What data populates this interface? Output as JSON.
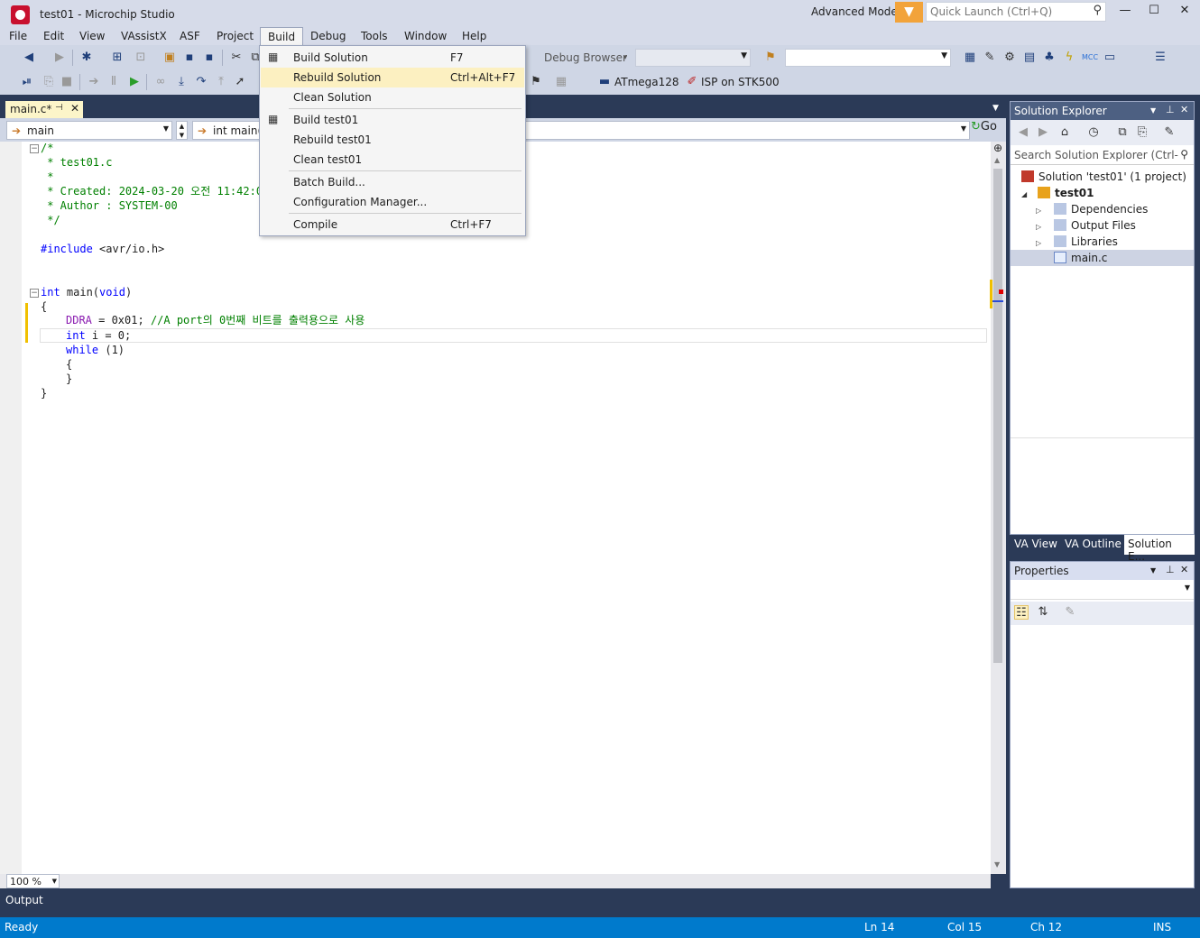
{
  "window": {
    "title": "test01 - Microchip Studio",
    "mode_label": "Advanced Mode",
    "quick_launch_placeholder": "Quick Launch (Ctrl+Q)"
  },
  "menu": [
    "File",
    "Edit",
    "View",
    "VAssistX",
    "ASF",
    "Project",
    "Build",
    "Debug",
    "Tools",
    "Window",
    "Help"
  ],
  "build_menu": {
    "items": [
      {
        "label": "Build Solution",
        "shortcut": "F7"
      },
      {
        "label": "Rebuild Solution",
        "shortcut": "Ctrl+Alt+F7"
      },
      {
        "label": "Clean Solution",
        "shortcut": ""
      },
      {
        "label": "Build test01",
        "shortcut": ""
      },
      {
        "label": "Rebuild test01",
        "shortcut": ""
      },
      {
        "label": "Clean test01",
        "shortcut": ""
      },
      {
        "label": "Batch Build...",
        "shortcut": ""
      },
      {
        "label": "Configuration Manager...",
        "shortcut": ""
      },
      {
        "label": "Compile",
        "shortcut": "Ctrl+F7"
      }
    ],
    "highlighted": "Rebuild Solution"
  },
  "toolbar": {
    "debug_browser": "Debug Browser",
    "device": "ATmega128",
    "tool": "ISP on STK500",
    "go_label": "Go"
  },
  "editor": {
    "tab_label": "main.c*",
    "nav_scope": "main",
    "nav_function": "int main(",
    "zoom": "100 %",
    "code": {
      "l1": "/*",
      "l2": " * test01.c",
      "l3": " *",
      "l4": " * Created: 2024-03-20 오전 11:42:0",
      "l5": " * Author : SYSTEM-00",
      "l6": " */",
      "l7_kw": "#include",
      "l7_rest": " <avr/io.h>",
      "l8_kw": "int",
      "l8_rest": " main(",
      "l8_kw2": "void",
      "l8_end": ")",
      "l9": "{",
      "l10_mac": "DDRA",
      "l10_rest": " = 0x01; ",
      "l10_cm": "//A port의 0번째 비트를 출력용으로 사용",
      "l11_kw": "int",
      "l11_rest": " i = 0;",
      "l12_kw": "while",
      "l12_rest": " (1)",
      "l13": "{",
      "l14": "}",
      "l15": "}"
    }
  },
  "solution_explorer": {
    "title": "Solution Explorer",
    "search_placeholder": "Search Solution Explorer (Ctrl-",
    "solution": "Solution 'test01' (1 project)",
    "project": "test01",
    "nodes": [
      "Dependencies",
      "Output Files",
      "Libraries",
      "main.c"
    ],
    "tabs": [
      "VA View",
      "VA Outline",
      "Solution E..."
    ]
  },
  "properties": {
    "title": "Properties"
  },
  "output": {
    "label": "Output"
  },
  "status": {
    "ready": "Ready",
    "ln": "Ln 14",
    "col": "Col 15",
    "ch": "Ch 12",
    "mode": "INS"
  }
}
